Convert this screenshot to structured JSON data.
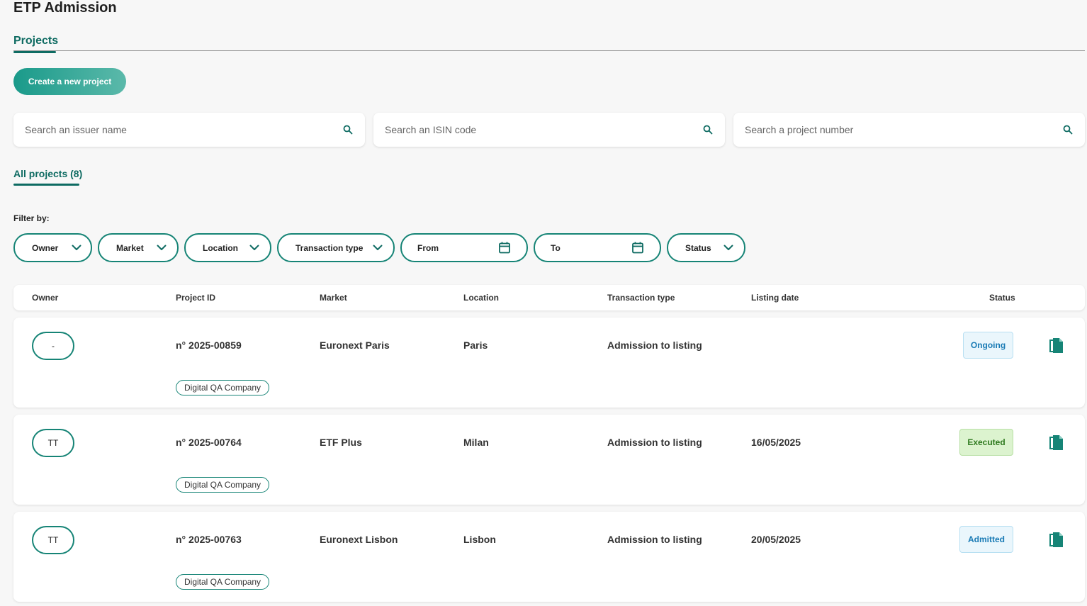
{
  "app": {
    "title": "ETP Admission"
  },
  "tabs": [
    {
      "label": "Projects"
    }
  ],
  "create_button": {
    "label": "Create a new project"
  },
  "search": [
    {
      "placeholder": "Search an issuer name"
    },
    {
      "placeholder": "Search an ISIN code"
    },
    {
      "placeholder": "Search a project number"
    }
  ],
  "subtab": {
    "label": "All projects (8)"
  },
  "filters": {
    "label": "Filter by:",
    "chips": [
      {
        "label": "Owner",
        "icon": "chevron-down-icon"
      },
      {
        "label": "Market",
        "icon": "chevron-down-icon"
      },
      {
        "label": "Location",
        "icon": "chevron-down-icon"
      },
      {
        "label": "Transaction type",
        "icon": "chevron-down-icon"
      },
      {
        "label": "From",
        "icon": "calendar-icon"
      },
      {
        "label": "To",
        "icon": "calendar-icon"
      },
      {
        "label": "Status",
        "icon": "chevron-down-icon"
      }
    ]
  },
  "table": {
    "columns": [
      "Owner",
      "Project ID",
      "Market",
      "Location",
      "Transaction type",
      "Listing date",
      "Status"
    ],
    "rows": [
      {
        "owner": "-",
        "project_id": "n° 2025-00859",
        "company": "Digital QA Company",
        "market": "Euronext Paris",
        "location": "Paris",
        "transaction_type": "Admission to listing",
        "listing_date": "",
        "status": "Ongoing"
      },
      {
        "owner": "TT",
        "project_id": "n° 2025-00764",
        "company": "Digital QA Company",
        "market": "ETF Plus",
        "location": "Milan",
        "transaction_type": "Admission to listing",
        "listing_date": "16/05/2025",
        "status": "Executed"
      },
      {
        "owner": "TT",
        "project_id": "n° 2025-00763",
        "company": "Digital QA Company",
        "market": "Euronext Lisbon",
        "location": "Lisbon",
        "transaction_type": "Admission to listing",
        "listing_date": "20/05/2025",
        "status": "Admitted"
      }
    ]
  },
  "colors": {
    "accent": "#0e6b62",
    "chip_border": "#168476",
    "status_ongoing": "#1a7bb5",
    "status_executed": "#2f7a1f",
    "status_admitted": "#1a7bb5"
  }
}
